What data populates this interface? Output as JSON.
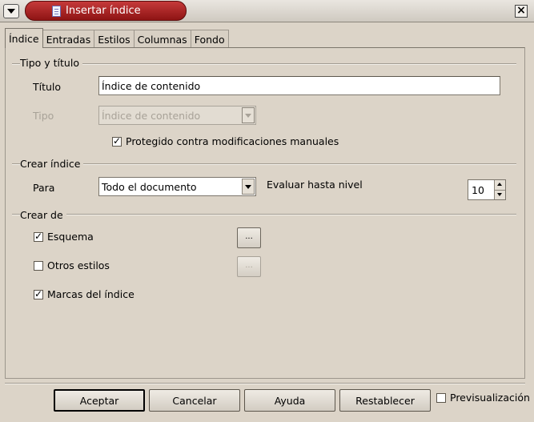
{
  "window": {
    "title": "Insertar índice",
    "close_glyph": "×"
  },
  "tabs": [
    {
      "label": "Índice",
      "active": true
    },
    {
      "label": "Entradas",
      "active": false
    },
    {
      "label": "Estilos",
      "active": false
    },
    {
      "label": "Columnas",
      "active": false
    },
    {
      "label": "Fondo",
      "active": false
    }
  ],
  "tipo_titulo": {
    "section_label": "Tipo y título",
    "titulo_label": "Título",
    "titulo_value": "Índice de contenido",
    "tipo_label": "Tipo",
    "tipo_value": "Índice de contenido",
    "protegido_label": "Protegido contra modificaciones manuales",
    "protegido_checked": true
  },
  "crear_indice": {
    "section_label": "Crear índice",
    "para_label": "Para",
    "para_value": "Todo el documento",
    "evaluar_label": "Evaluar hasta nivel",
    "nivel_value": "10"
  },
  "crear_de": {
    "section_label": "Crear de",
    "esquema_label": "Esquema",
    "esquema_checked": true,
    "esquema_button": "...",
    "otros_label": "Otros estilos",
    "otros_checked": false,
    "otros_button": "...",
    "marcas_label": "Marcas del índice",
    "marcas_checked": true
  },
  "buttons": {
    "aceptar": "Aceptar",
    "cancelar": "Cancelar",
    "ayuda": "Ayuda",
    "restablecer": "Restablecer",
    "preview_label": "Previsualización",
    "preview_checked": false
  },
  "colors": {
    "dialog_bg": "#dcd4c8",
    "title_pill": "#a82020"
  }
}
